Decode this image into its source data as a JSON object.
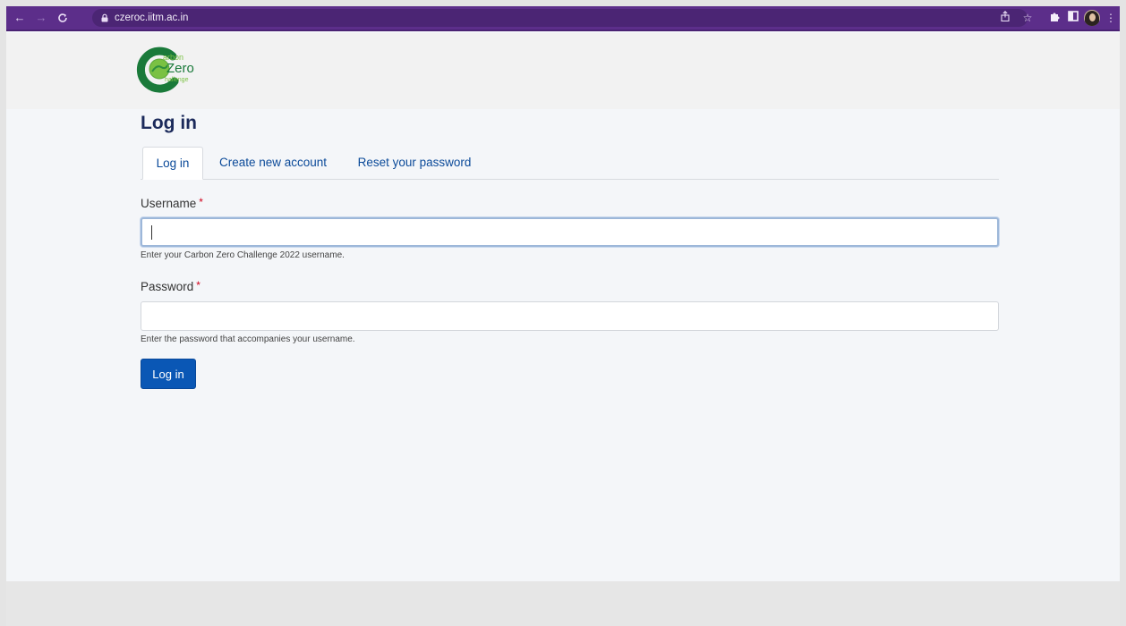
{
  "browser": {
    "url": "czeroc.iitm.ac.in",
    "back_icon": "arrow-left",
    "forward_icon": "arrow-right",
    "reload_icon": "reload",
    "share_icon": "share",
    "bookmark_icon": "star",
    "extensions_icon": "puzzle",
    "sidepanel_icon": "square",
    "menu_icon": "three-dots"
  },
  "logo": {
    "line1": "arbon",
    "line2": "Zero",
    "line3": "hallenge"
  },
  "page": {
    "title": "Log in"
  },
  "tabs": [
    {
      "label": "Log in",
      "active": true
    },
    {
      "label": "Create new account",
      "active": false
    },
    {
      "label": "Reset your password",
      "active": false
    }
  ],
  "form": {
    "username": {
      "label": "Username",
      "required_marker": "*",
      "value": "",
      "description": "Enter your Carbon Zero Challenge 2022 username."
    },
    "password": {
      "label": "Password",
      "required_marker": "*",
      "value": "",
      "description": "Enter the password that accompanies your username."
    },
    "submit_label": "Log in"
  },
  "colors": {
    "browser_toolbar": "#5c2e8a",
    "title": "#1b2a5b",
    "link": "#0b4a99",
    "primary_button": "#0a57b5",
    "required": "#d0021b",
    "logo_dark_green": "#1a7a3a",
    "logo_light_green": "#7ac143"
  }
}
